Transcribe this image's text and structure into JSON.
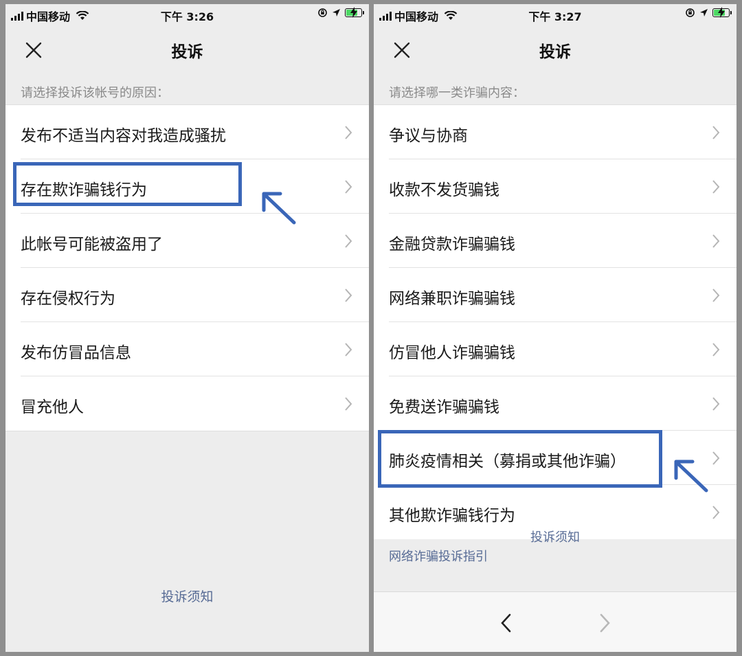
{
  "colors": {
    "highlight": "#3a66b8",
    "link": "#576b95",
    "background": "#ededed"
  },
  "left": {
    "status": {
      "carrier": "中国移动",
      "time": "下午 3:26"
    },
    "title": "投诉",
    "section_label": "请选择投诉该帐号的原因：",
    "items": [
      {
        "label": "发布不适当内容对我造成骚扰"
      },
      {
        "label": "存在欺诈骗钱行为"
      },
      {
        "label": "此帐号可能被盗用了"
      },
      {
        "label": "存在侵权行为"
      },
      {
        "label": "发布仿冒品信息"
      },
      {
        "label": "冒充他人"
      }
    ],
    "footer_link": "投诉须知"
  },
  "right": {
    "status": {
      "carrier": "中国移动",
      "time": "下午 3:27"
    },
    "title": "投诉",
    "section_label": "请选择哪一类诈骗内容：",
    "items": [
      {
        "label": "争议与协商"
      },
      {
        "label": "收款不发货骗钱"
      },
      {
        "label": "金融贷款诈骗骗钱"
      },
      {
        "label": "网络兼职诈骗骗钱"
      },
      {
        "label": "仿冒他人诈骗骗钱"
      },
      {
        "label": "免费送诈骗骗钱"
      },
      {
        "label": "肺炎疫情相关（募捐或其他诈骗）"
      },
      {
        "label": "其他欺诈骗钱行为"
      }
    ],
    "footer_link": "投诉须知",
    "guide_link": "网络诈骗投诉指引"
  }
}
